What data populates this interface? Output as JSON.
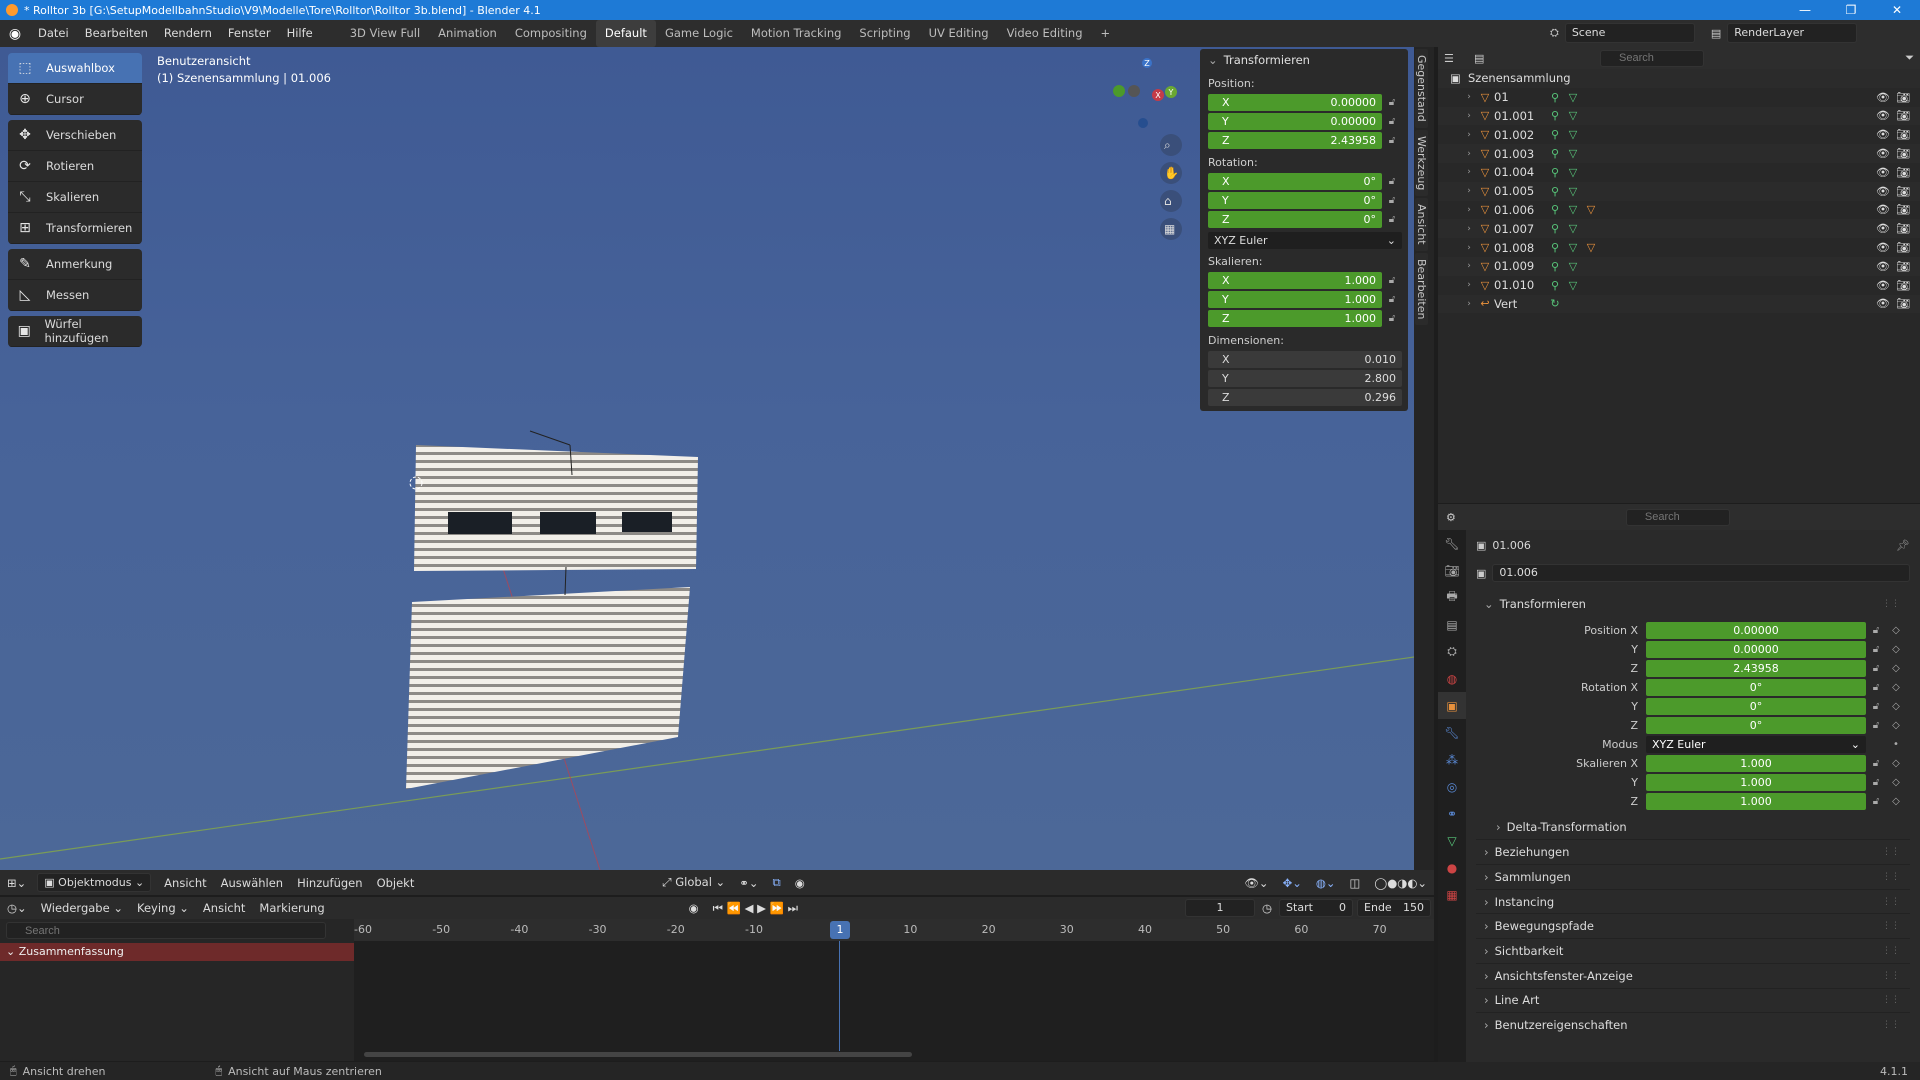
{
  "window": {
    "title": "* Rolltor 3b [G:\\SetupModellbahnStudio\\V9\\Modelle\\Tore\\Rolltor\\Rolltor 3b.blend] - Blender 4.1",
    "minimize": "—",
    "maximize": "❐",
    "close": "✕"
  },
  "menu": [
    "Datei",
    "Bearbeiten",
    "Rendern",
    "Fenster",
    "Hilfe"
  ],
  "workspaces": [
    "3D View Full",
    "Animation",
    "Compositing",
    "Default",
    "Game Logic",
    "Motion Tracking",
    "Scripting",
    "UV Editing",
    "Video Editing"
  ],
  "workspace_active": "Default",
  "workspace_add": "+",
  "scene": {
    "name": "Scene",
    "view_layer": "RenderLayer"
  },
  "viewport": {
    "view_name": "Benutzeransicht",
    "collection_info": "(1) Szenensammlung | 01.006"
  },
  "tools": [
    {
      "label": "Auswahlbox",
      "icon": "select-box-icon",
      "glyph": "⬚",
      "active": true
    },
    {
      "label": "Cursor",
      "icon": "cursor-icon",
      "glyph": "⊕"
    },
    {
      "label": "Verschieben",
      "icon": "move-icon",
      "glyph": "✥"
    },
    {
      "label": "Rotieren",
      "icon": "rotate-icon",
      "glyph": "⟳"
    },
    {
      "label": "Skalieren",
      "icon": "scale-icon",
      "glyph": "⤡"
    },
    {
      "label": "Transformieren",
      "icon": "transform-icon",
      "glyph": "⊞"
    },
    {
      "label": "Anmerkung",
      "icon": "annotate-icon",
      "glyph": "✎"
    },
    {
      "label": "Messen",
      "icon": "measure-icon",
      "glyph": "📐"
    },
    {
      "label": "Würfel hinzufügen",
      "icon": "add-cube-icon",
      "glyph": "▣"
    }
  ],
  "npanel": {
    "title": "Transformieren",
    "position_label": "Position:",
    "position": {
      "x": "0.00000",
      "y": "0.00000",
      "z": "2.43958"
    },
    "rotation_label": "Rotation:",
    "rotation": {
      "x": "0°",
      "y": "0°",
      "z": "0°"
    },
    "rotation_mode": "XYZ Euler",
    "scale_label": "Skalieren:",
    "scale": {
      "x": "1.000",
      "y": "1.000",
      "z": "1.000"
    },
    "dimensions_label": "Dimensionen:",
    "dimensions": {
      "x": "0.010",
      "y": "2.800",
      "z": "0.296"
    },
    "axis_x": "X",
    "axis_y": "Y",
    "axis_z": "Z"
  },
  "sidebar_tabs": [
    "Gegenstand",
    "Werkzeug",
    "Ansicht",
    "Bearbeiten"
  ],
  "outliner": {
    "search_placeholder": "Search",
    "collection": "Szenensammlung",
    "items": [
      "01",
      "01.001",
      "01.002",
      "01.003",
      "01.004",
      "01.005",
      "01.006",
      "01.007",
      "01.008",
      "01.009",
      "01.010",
      "Vert"
    ]
  },
  "properties": {
    "search_placeholder": "Search",
    "object_name": "01.006",
    "object_data_name": "01.006",
    "section_title": "Transformieren",
    "position_x_label": "Position X",
    "y_label": "Y",
    "z_label": "Z",
    "position": {
      "x": "0.00000",
      "y": "0.00000",
      "z": "2.43958"
    },
    "rotation_x_label": "Rotation X",
    "rotation": {
      "x": "0°",
      "y": "0°",
      "z": "0°"
    },
    "mode_label": "Modus",
    "mode_value": "XYZ Euler",
    "scale_x_label": "Skalieren X",
    "scale": {
      "x": "1.000",
      "y": "1.000",
      "z": "1.000"
    },
    "delta": "Delta-Transformation",
    "sections": [
      "Beziehungen",
      "Sammlungen",
      "Instancing",
      "Bewegungspfade",
      "Sichtbarkeit",
      "Ansichtsfenster-Anzeige",
      "Line Art",
      "Benutzereigenschaften"
    ]
  },
  "viewport_header": {
    "mode": "Objektmodus",
    "menus": [
      "Ansicht",
      "Auswählen",
      "Hinzufügen",
      "Objekt"
    ],
    "orientation": "Global"
  },
  "timeline": {
    "menus": [
      "Wiedergabe",
      "Keying",
      "Ansicht",
      "Markierung"
    ],
    "current_frame": "1",
    "start_label": "Start",
    "start": "0",
    "end_label": "Ende",
    "end": "150",
    "search_placeholder": "Search",
    "summary": "Zusammenfassung",
    "ticks": [
      "-60",
      "-50",
      "-40",
      "-30",
      "-20",
      "-10",
      "1",
      "10",
      "20",
      "30",
      "40",
      "50",
      "60",
      "70"
    ]
  },
  "status": {
    "left": "Ansicht drehen",
    "middle": "Ansicht auf Maus zentrieren",
    "version": "4.1.1"
  },
  "colors": {
    "accent": "#4772b3",
    "field_green": "#4c9a2b",
    "object_orange": "#e8913c",
    "titlebar": "#1e7ad6"
  }
}
